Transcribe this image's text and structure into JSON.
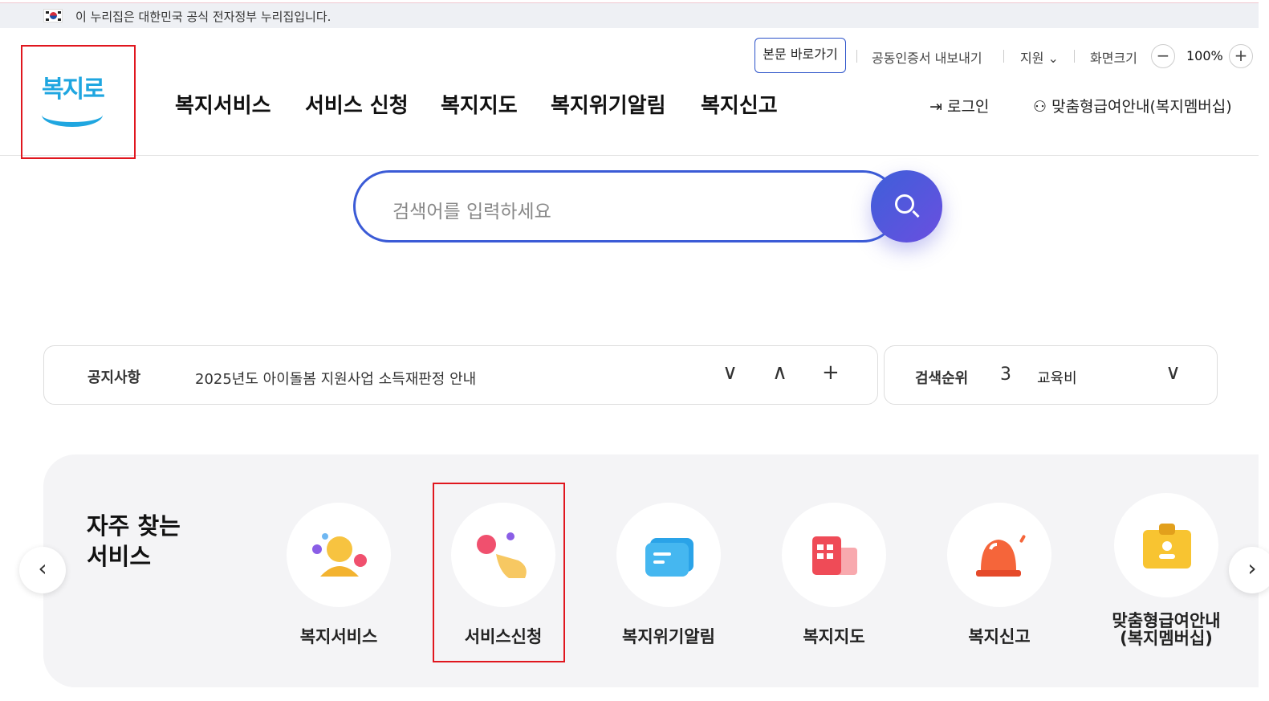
{
  "gov_bar": {
    "text": "이 누리집은 대한민국 공식 전자정부 누리집입니다."
  },
  "logo": {
    "text": "복지로"
  },
  "gnb": [
    "복지서비스",
    "서비스 신청",
    "복지지도",
    "복지위기알림",
    "복지신고"
  ],
  "util": {
    "skip": "본문 바로가기",
    "cert": "공동인증서 내보내기",
    "support": "지원",
    "screen_size": "화면크기",
    "zoom_out": "−",
    "zoom": "100%",
    "zoom_in": "+"
  },
  "member": {
    "login": "로그인",
    "membership": "맞춤형급여안내(복지멤버십)"
  },
  "search": {
    "placeholder": "검색어를 입력하세요"
  },
  "notice": {
    "label": "공지사항",
    "message": "2025년도 아이돌봄 지원사업 소득재판정 안내",
    "down": "∨",
    "up": "∧",
    "more": "+"
  },
  "rank": {
    "label": "검색순위",
    "number": "3",
    "keyword": "교육비",
    "chevron": "∨"
  },
  "frequent": {
    "title": "자주 찾는 서비스",
    "prev": "‹",
    "next": "›",
    "items": [
      {
        "label": "복지서비스",
        "icon": "people-icon"
      },
      {
        "label": "서비스신청",
        "icon": "tap-hand-icon"
      },
      {
        "label": "복지위기알림",
        "icon": "message-icon"
      },
      {
        "label": "복지지도",
        "icon": "building-icon"
      },
      {
        "label": "복지신고",
        "icon": "siren-icon"
      },
      {
        "label": "맞춤형급여안내(복지멤버십)",
        "icon": "id-badge-icon"
      }
    ]
  }
}
